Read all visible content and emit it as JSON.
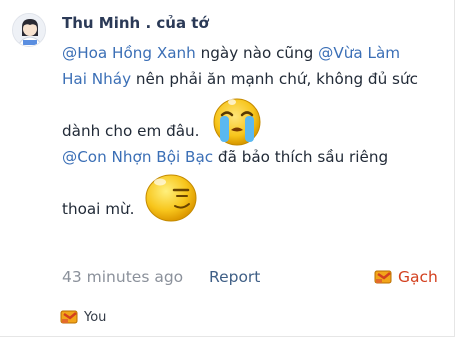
{
  "comment": {
    "author": "Thu Minh . của tớ",
    "line1_mention1": "@Hoa Hồng Xanh",
    "line1_text": " ngày nào cũng ",
    "line1_mention2": "@Vừa Làm",
    "line2_mention": "Hai Nháy",
    "line2_text": " nên phải ăn mạnh chứ, không đủ sức",
    "line3_text": "dành cho em đâu.",
    "line4_mention": "@Con Nhợn Bội Bạc",
    "line4_text": " đã bảo thích sầu riêng",
    "line5_text": "thoai mừ."
  },
  "meta": {
    "time": "43 minutes ago",
    "report_label": "Report",
    "reaction_label": "Gạch"
  },
  "reactions": {
    "you_label": "You"
  },
  "icons": {
    "avatar": "avatar-icon",
    "crying_emoji": "crying-emoji-icon",
    "smug_emoji": "smug-emoji-icon",
    "reaction": "brick-reaction-icon"
  },
  "colors": {
    "mention": "#3b6fb6",
    "author": "#2b3a57",
    "reaction": "#d3401f",
    "meta": "#8b919b"
  }
}
